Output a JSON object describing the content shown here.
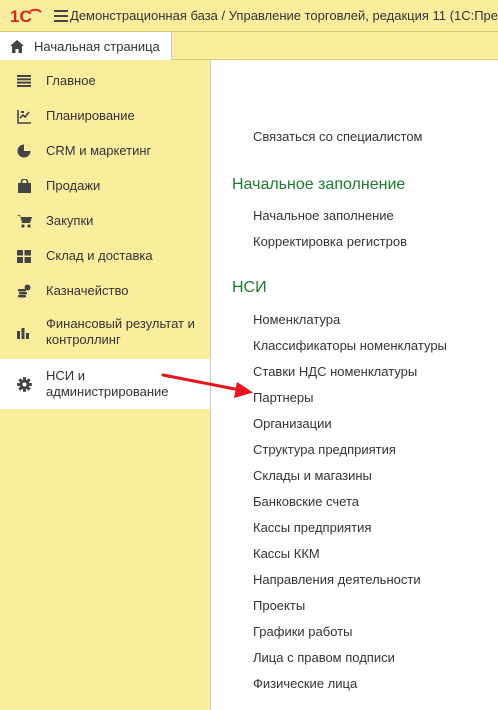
{
  "app": {
    "title": "Демонстрационная база / Управление торговлей, редакция 11  (1С:Пре",
    "logo_text": "1С"
  },
  "tabs": {
    "home_label": "Начальная страница"
  },
  "sidebar": {
    "items": [
      {
        "label": "Главное",
        "icon": "menu-lines-icon"
      },
      {
        "label": "Планирование",
        "icon": "planning-icon"
      },
      {
        "label": "CRM и маркетинг",
        "icon": "pie-chart-icon"
      },
      {
        "label": "Продажи",
        "icon": "shopping-bag-icon"
      },
      {
        "label": "Закупки",
        "icon": "shopping-cart-icon"
      },
      {
        "label": "Склад и доставка",
        "icon": "warehouse-grid-icon"
      },
      {
        "label": "Казначейство",
        "icon": "coins-icon"
      },
      {
        "label": "Финансовый результат и контроллинг",
        "icon": "bar-chart-icon"
      },
      {
        "label": "НСИ и администрирование",
        "icon": "gear-icon",
        "active": true
      }
    ]
  },
  "main": {
    "top_links": [
      "Связаться со специалистом"
    ],
    "sections": [
      {
        "title": "Начальное заполнение",
        "links": [
          "Начальное заполнение",
          "Корректировка регистров"
        ]
      },
      {
        "title": "НСИ",
        "links": [
          "Номенклатура",
          "Классификаторы номенклатуры",
          "Ставки НДС номенклатуры",
          "Партнеры",
          "Организации",
          "Структура предприятия",
          "Склады и магазины",
          "Банковские счета",
          "Кассы предприятия",
          "Кассы ККМ",
          "Направления деятельности",
          "Проекты",
          "Графики работы",
          "Лица с правом подписи",
          "Физические лица"
        ]
      }
    ]
  },
  "colors": {
    "panel": "#fbed9e",
    "section_title": "#1e7a2e",
    "arrow": "#e8131b",
    "logo": "#d9261c"
  }
}
